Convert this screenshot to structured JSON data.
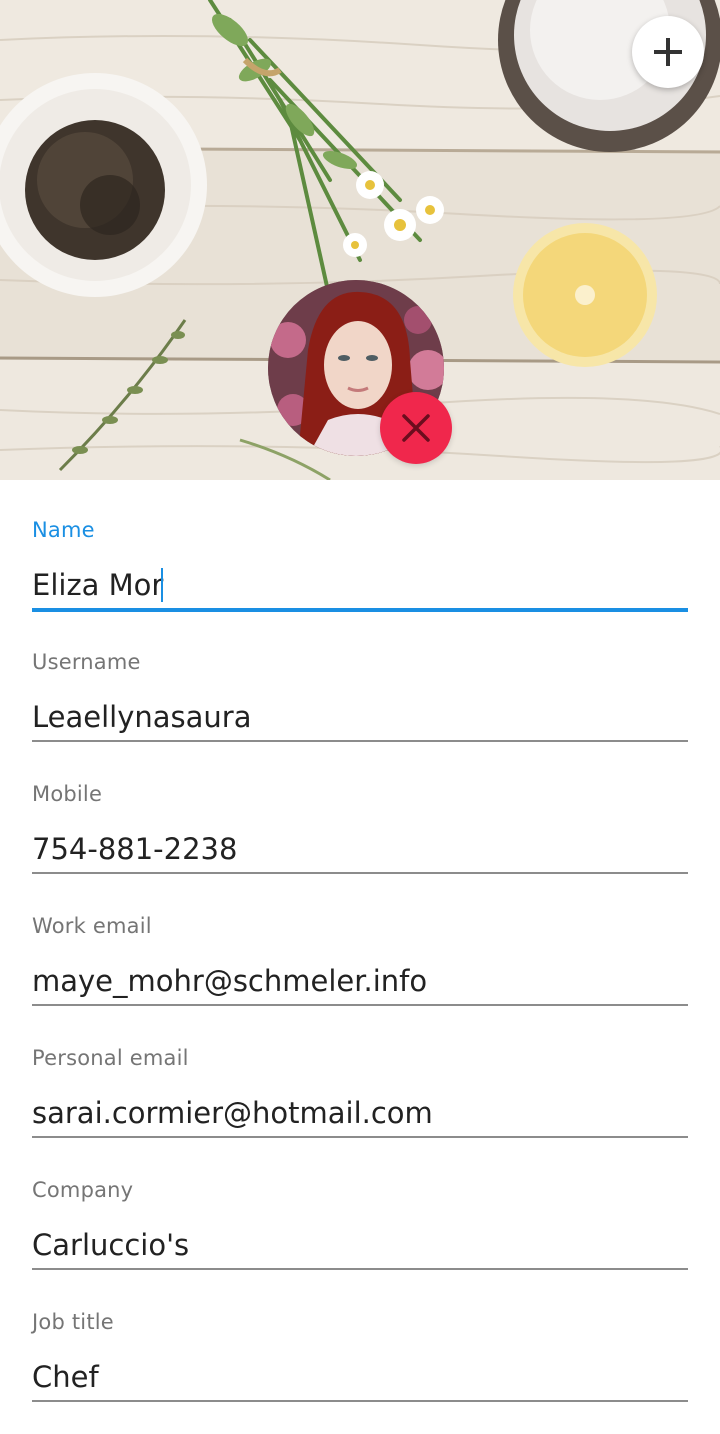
{
  "header": {
    "add_icon": "plus-icon",
    "remove_icon": "close-icon",
    "colors": {
      "remove_button": "#f0274c",
      "accent": "#1a8fe3"
    }
  },
  "form": {
    "fields": [
      {
        "label": "Name",
        "value": "Eliza Mor"
      },
      {
        "label": "Username",
        "value": "Leaellynasaura"
      },
      {
        "label": "Mobile",
        "value": "754-881-2238"
      },
      {
        "label": "Work email",
        "value": "maye_mohr@schmeler.info"
      },
      {
        "label": "Personal email",
        "value": "sarai.cormier@hotmail.com"
      },
      {
        "label": "Company",
        "value": "Carluccio's"
      },
      {
        "label": "Job title",
        "value": "Chef"
      }
    ]
  }
}
